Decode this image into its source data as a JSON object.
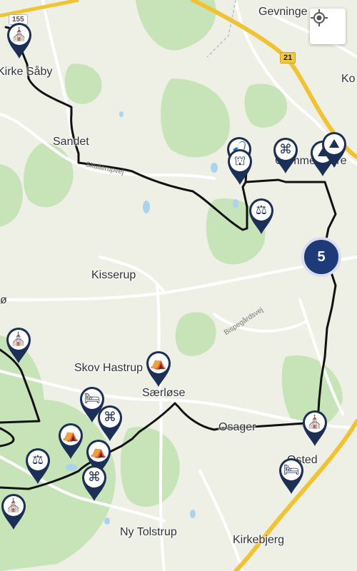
{
  "map": {
    "places": {
      "gevninge": "Gevninge",
      "kirke_saaby": "Kirke Såby",
      "ko": "Ko",
      "sandet": "Sandet",
      "gammel_lejre": "Gammel Lejre",
      "kisserup": "Kisserup",
      "skov_hastrup": "Skov Hastrup",
      "saerloese": "Særløse",
      "osager": "Osager",
      "osted": "Osted",
      "ny_tolstrup": "Ny Tolstrup",
      "kirkebjerg": "Kirkebjerg",
      "oe_edge": "ø"
    },
    "roads": {
      "route_155": "155",
      "route_21": "21",
      "skullerupvej": "Skullerupvej",
      "bispegaardsvej": "Bispegårdsvej"
    },
    "cluster_count": "5",
    "locate_button": "my-location",
    "colors": {
      "route_line": "#111111",
      "pin_fill": "#1c2f57",
      "cluster_fill": "#1e3a78",
      "highway": "#f5c842",
      "forest": "#c7e3b8",
      "water": "#aad3ee",
      "land": "#eef0e6"
    },
    "markers": [
      {
        "icon": "church-icon"
      },
      {
        "icon": "fishing-icon"
      },
      {
        "icon": "heritage-icon"
      },
      {
        "icon": "attraction-icon"
      },
      {
        "icon": "landscape-icon"
      },
      {
        "icon": "landscape-icon"
      },
      {
        "icon": "playground-icon"
      },
      {
        "icon": "church-icon"
      },
      {
        "icon": "shelter-icon"
      },
      {
        "icon": "lodging-icon"
      },
      {
        "icon": "attraction-icon"
      },
      {
        "icon": "camping-icon"
      },
      {
        "icon": "shelter-icon"
      },
      {
        "icon": "playground-icon"
      },
      {
        "icon": "attraction-icon"
      },
      {
        "icon": "church-icon"
      },
      {
        "icon": "lodging-icon"
      }
    ]
  }
}
